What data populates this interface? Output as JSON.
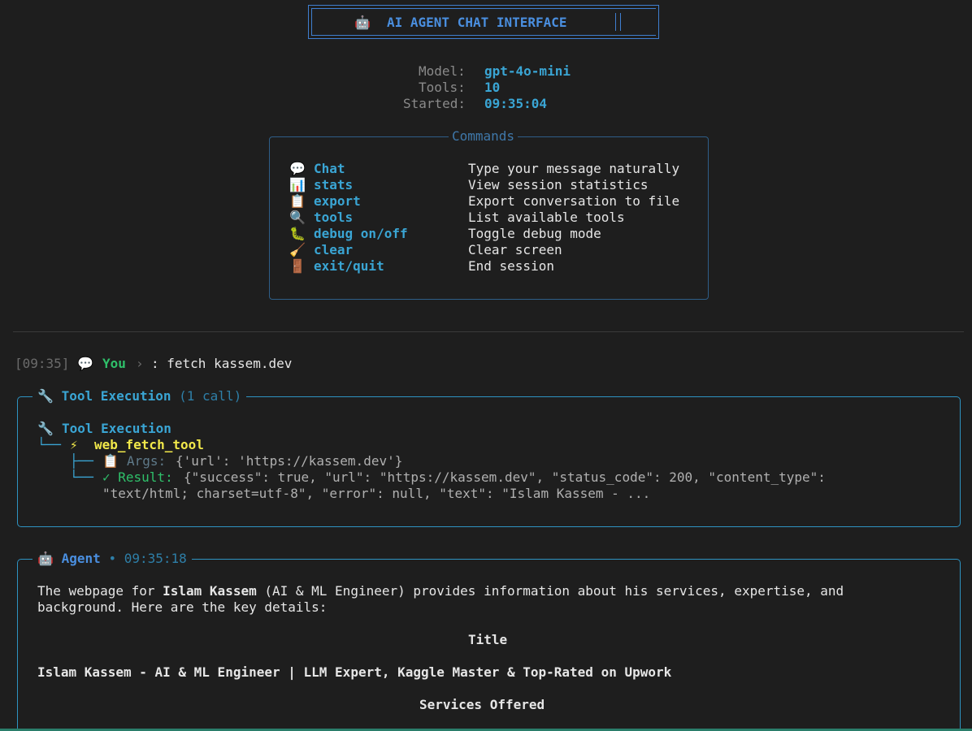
{
  "header": {
    "icon": "🤖",
    "title": "AI AGENT CHAT INTERFACE"
  },
  "session_info": [
    {
      "label": "Model:",
      "value": "gpt-4o-mini"
    },
    {
      "label": "Tools:",
      "value": "10"
    },
    {
      "label": "Started:",
      "value": "09:35:04"
    }
  ],
  "commands": {
    "title": "Commands",
    "items": [
      {
        "icon": "💬",
        "icon_name": "speech-bubble-icon",
        "name": "Chat",
        "desc": "Type your message naturally"
      },
      {
        "icon": "📊",
        "icon_name": "bar-chart-icon",
        "name": "stats",
        "desc": "View session statistics"
      },
      {
        "icon": "📋",
        "icon_name": "clipboard-icon",
        "name": "export",
        "desc": "Export conversation to file"
      },
      {
        "icon": "🔍",
        "icon_name": "magnifier-icon",
        "name": "tools",
        "desc": "List available tools"
      },
      {
        "icon": "🐛",
        "icon_name": "bug-icon",
        "name": "debug on/off",
        "desc": "Toggle debug mode"
      },
      {
        "icon": "🧹",
        "icon_name": "broom-icon",
        "name": "clear",
        "desc": "Clear screen"
      },
      {
        "icon": "🚪",
        "icon_name": "door-icon",
        "name": "exit/quit",
        "desc": "End session"
      }
    ]
  },
  "user_message": {
    "time": "[09:35]",
    "icon": "💬",
    "who": "You",
    "separator": "›",
    "text": ": fetch kassem.dev"
  },
  "tool_panel": {
    "icon": "🔧",
    "title": "Tool Execution",
    "count": "(1 call)",
    "inner_title": "Tool Execution",
    "tree1": "└──",
    "tool_icon": "⚡",
    "tool_name": "web_fetch_tool",
    "tree2": "├──",
    "args_icon": "📋",
    "args_label": "Args:",
    "args_value": "{'url': 'https://kassem.dev'}",
    "tree3": "└──",
    "result_label": "✓ Result:",
    "result_line1": "{\"success\": true, \"url\": \"https://kassem.dev\", \"status_code\": 200, \"content_type\":",
    "result_line2": "\"text/html; charset=utf-8\", \"error\": null, \"text\": \"Islam Kassem - ..."
  },
  "agent_panel": {
    "icon": "🤖",
    "title": "Agent",
    "dot": "•",
    "time": "09:35:18",
    "intro_before": "The webpage for ",
    "intro_bold": "Islam Kassem",
    "intro_after": " (AI & ML Engineer) provides information about his services, expertise, and",
    "intro_line2": "background. Here are the key details:",
    "heading_title": "Title",
    "page_title": "Islam Kassem - AI & ML Engineer | LLM Expert, Kaggle Master & Top-Rated on Upwork",
    "heading_services": "Services Offered"
  }
}
